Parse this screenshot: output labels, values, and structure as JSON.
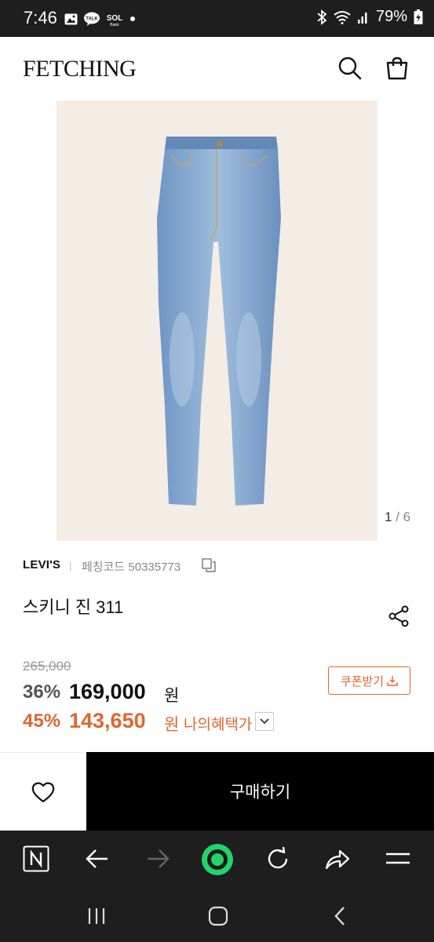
{
  "status_bar": {
    "time": "7:46",
    "battery": "79%",
    "notification_icons": [
      "gallery-icon",
      "kakaotalk-icon",
      "sol-bank-icon",
      "dot-icon"
    ],
    "system_icons": [
      "bluetooth-icon",
      "wifi-icon",
      "signal-icon",
      "battery-icon"
    ]
  },
  "header": {
    "logo": "FETCHING",
    "icons": [
      "search-icon",
      "shopping-bag-icon"
    ]
  },
  "gallery": {
    "current": "1",
    "separator": " / ",
    "total": "6"
  },
  "product": {
    "brand": "LEVI'S",
    "separator": "|",
    "code_label": "페칭코드 50335773",
    "title": "스키니 진 311"
  },
  "price": {
    "original": "265,000",
    "discount_rate": "36%",
    "sale_price": "169,000",
    "currency": "원",
    "my_discount_rate": "45%",
    "my_price": "143,650",
    "my_benefit_label": "나의혜택가"
  },
  "coupon": {
    "label": "쿠폰받기"
  },
  "actions": {
    "buy_label": "구매하기"
  },
  "browser_toolbar": {
    "icons": [
      "naver-n-icon",
      "back-arrow-icon",
      "forward-arrow-icon",
      "green-dot-home-icon",
      "refresh-icon",
      "share-arrow-icon",
      "menu-icon"
    ]
  },
  "system_nav": {
    "icons": [
      "recent-apps-icon",
      "home-icon",
      "back-icon"
    ]
  },
  "colors": {
    "accent": "#e0662e",
    "buy_button": "#000000",
    "image_bg": "#f3ede6",
    "system_bar": "#1e1e1e",
    "home_green": "#22d46a"
  }
}
